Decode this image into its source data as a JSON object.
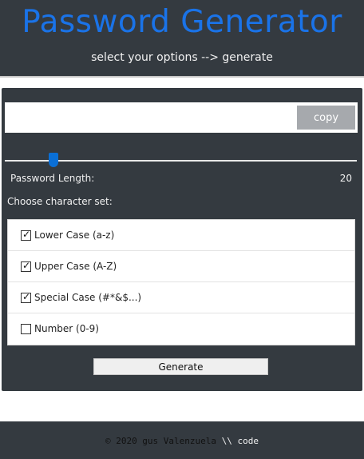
{
  "header": {
    "title": "Password Generator",
    "subtitle": "select your options --> generate"
  },
  "output": {
    "value": "",
    "copy_label": "copy"
  },
  "length": {
    "label": "Password Length:",
    "value": "20",
    "slider_level": 0.15
  },
  "charset": {
    "label": "Choose character set:",
    "options": [
      {
        "label": "Lower Case (a-z)",
        "checked": true
      },
      {
        "label": "Upper Case (A-Z)",
        "checked": true
      },
      {
        "label": "Special Case (#*&$...)",
        "checked": true
      },
      {
        "label": "Number (0-9)",
        "checked": false
      }
    ]
  },
  "actions": {
    "generate_label": "Generate"
  },
  "footer": {
    "copyright": "© 2020 gus Valenzuela",
    "sep": "\\\\",
    "code": "code"
  },
  "colors": {
    "accent": "#1a73e8",
    "dark_bg": "#343a40",
    "slider": "#0a6fd6"
  }
}
